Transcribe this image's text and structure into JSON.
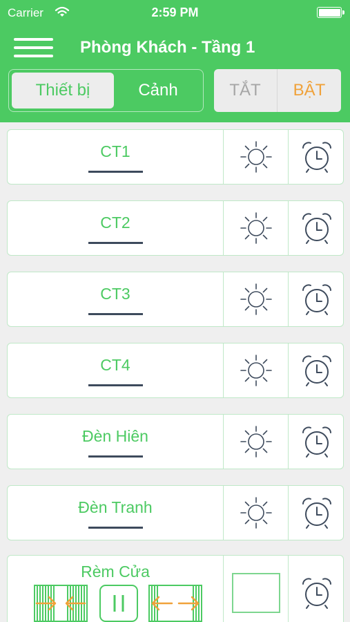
{
  "status_bar": {
    "carrier": "Carrier",
    "time": "2:59 PM",
    "wifi_icon": "wifi-icon",
    "battery_icon": "battery-icon"
  },
  "nav": {
    "title": "Phòng Khách - Tầng 1",
    "menu_icon": "hamburger-menu-icon"
  },
  "mode_tabs": {
    "devices": "Thiết bị",
    "scenes": "Cảnh",
    "selected": "devices"
  },
  "power": {
    "off_label": "TẮT",
    "on_label": "BẬT"
  },
  "devices": [
    {
      "label": "CT1"
    },
    {
      "label": "CT2"
    },
    {
      "label": "CT3"
    },
    {
      "label": "CT4"
    },
    {
      "label": "Đèn Hiên"
    },
    {
      "label": "Đèn Tranh"
    }
  ],
  "curtain": {
    "label": "Rèm Cửa"
  },
  "icons": {
    "light": "sun-icon",
    "schedule": "alarm-clock-icon",
    "open": "curtain-open-icon",
    "pause": "pause-icon",
    "close": "curtain-close-icon"
  },
  "colors": {
    "primary": "#4cca62",
    "on_accent": "#f0a23a",
    "off_text": "#a6a6a6",
    "icon_stroke": "#3d4a5c"
  }
}
